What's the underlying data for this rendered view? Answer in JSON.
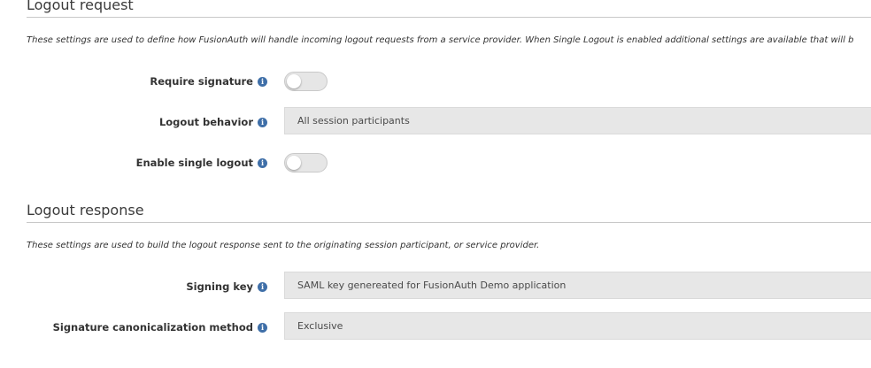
{
  "logout_request": {
    "heading": "Logout request",
    "description": "These settings are used to define how FusionAuth will handle incoming logout requests from a service provider. When Single Logout is enabled additional settings are available that will b",
    "require_signature": {
      "label": "Require signature",
      "enabled": false
    },
    "logout_behavior": {
      "label": "Logout behavior",
      "value": "All session participants"
    },
    "enable_single_logout": {
      "label": "Enable single logout",
      "enabled": false
    }
  },
  "logout_response": {
    "heading": "Logout response",
    "description": "These settings are used to build the logout response sent to the originating session participant, or service provider.",
    "signing_key": {
      "label": "Signing key",
      "value": "SAML key genereated for FusionAuth Demo application"
    },
    "signature_canonicalization_method": {
      "label": "Signature canonicalization method",
      "value": "Exclusive"
    }
  },
  "colors": {
    "info_icon": "#3f6fa8",
    "field_background": "#e7e7e7",
    "toggle_off": "#e6e6e6"
  },
  "icons": {
    "info": "info-circle-icon"
  }
}
